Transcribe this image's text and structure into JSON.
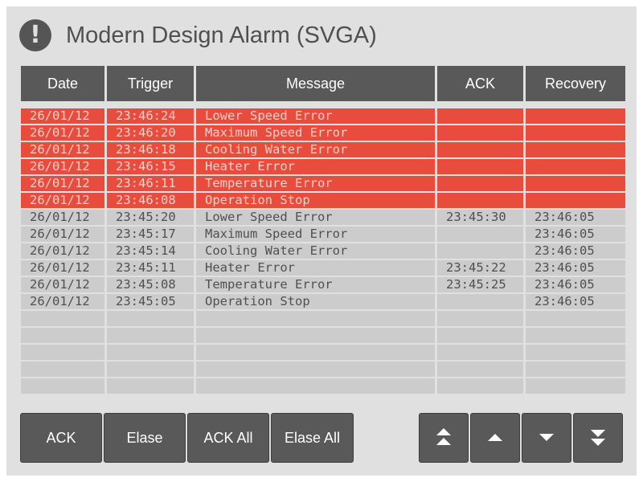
{
  "header": {
    "icon": "exclamation-circle-icon",
    "title": "Modern Design Alarm (SVGA)"
  },
  "table": {
    "columns": [
      "Date",
      "Trigger",
      "Message",
      "ACK",
      "Recovery"
    ],
    "rows": [
      {
        "date": "26/01/12",
        "trigger": "23:46:24",
        "message": "Lower Speed Error",
        "ack": "",
        "recovery": "",
        "active": true
      },
      {
        "date": "26/01/12",
        "trigger": "23:46:20",
        "message": "Maximum Speed Error",
        "ack": "",
        "recovery": "",
        "active": true
      },
      {
        "date": "26/01/12",
        "trigger": "23:46:18",
        "message": "Cooling Water Error",
        "ack": "",
        "recovery": "",
        "active": true
      },
      {
        "date": "26/01/12",
        "trigger": "23:46:15",
        "message": "Heater Error",
        "ack": "",
        "recovery": "",
        "active": true
      },
      {
        "date": "26/01/12",
        "trigger": "23:46:11",
        "message": "Temperature Error",
        "ack": "",
        "recovery": "",
        "active": true
      },
      {
        "date": "26/01/12",
        "trigger": "23:46:08",
        "message": "Operation Stop",
        "ack": "",
        "recovery": "",
        "active": true
      },
      {
        "date": "26/01/12",
        "trigger": "23:45:20",
        "message": "Lower Speed Error",
        "ack": "23:45:30",
        "recovery": "23:46:05",
        "active": false
      },
      {
        "date": "26/01/12",
        "trigger": "23:45:17",
        "message": "Maximum Speed Error",
        "ack": "",
        "recovery": "23:46:05",
        "active": false
      },
      {
        "date": "26/01/12",
        "trigger": "23:45:14",
        "message": "Cooling Water Error",
        "ack": "",
        "recovery": "23:46:05",
        "active": false
      },
      {
        "date": "26/01/12",
        "trigger": "23:45:11",
        "message": "Heater Error",
        "ack": "23:45:22",
        "recovery": "23:46:05",
        "active": false
      },
      {
        "date": "26/01/12",
        "trigger": "23:45:08",
        "message": "Temperature Error",
        "ack": "23:45:25",
        "recovery": "23:46:05",
        "active": false
      },
      {
        "date": "26/01/12",
        "trigger": "23:45:05",
        "message": "Operation Stop",
        "ack": "",
        "recovery": "23:46:05",
        "active": false
      },
      {
        "date": "",
        "trigger": "",
        "message": "",
        "ack": "",
        "recovery": "",
        "active": false
      },
      {
        "date": "",
        "trigger": "",
        "message": "",
        "ack": "",
        "recovery": "",
        "active": false
      },
      {
        "date": "",
        "trigger": "",
        "message": "",
        "ack": "",
        "recovery": "",
        "active": false
      },
      {
        "date": "",
        "trigger": "",
        "message": "",
        "ack": "",
        "recovery": "",
        "active": false
      },
      {
        "date": "",
        "trigger": "",
        "message": "",
        "ack": "",
        "recovery": "",
        "active": false
      }
    ]
  },
  "buttons": {
    "ack": "ACK",
    "elase": "Elase",
    "ack_all": "ACK All",
    "elase_all": "Elase All"
  },
  "nav": [
    {
      "icon": "double-chevron-up-icon"
    },
    {
      "icon": "triangle-up-icon"
    },
    {
      "icon": "triangle-down-icon"
    },
    {
      "icon": "double-chevron-down-icon"
    }
  ],
  "colors": {
    "active_alarm_row": "#e84c3d",
    "active_alarm_text": "#ffd2cc",
    "header_bg": "#595959",
    "row_bg": "#cccccc",
    "panel_bg": "#e0e0e0"
  }
}
